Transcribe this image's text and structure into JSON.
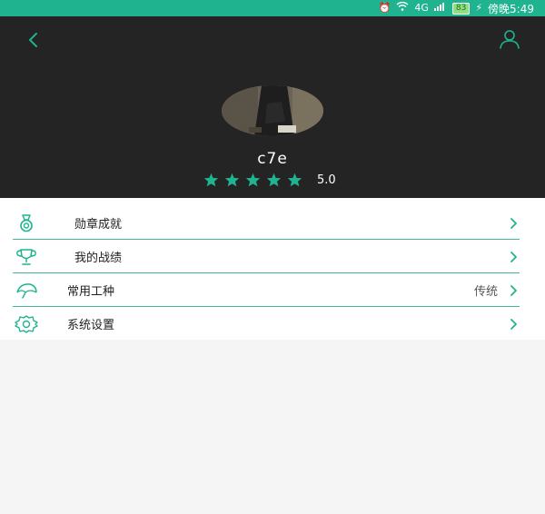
{
  "status_bar": {
    "battery": "83",
    "time": "傍晚5:49",
    "network": "4G"
  },
  "profile": {
    "username": "c7e",
    "rating_score": "5.0",
    "stars_filled": 5
  },
  "menu": {
    "items": [
      {
        "label": "勋章成就",
        "value": ""
      },
      {
        "label": "我的战绩",
        "value": ""
      },
      {
        "label": "常用工种",
        "value": "传统"
      },
      {
        "label": "系统设置",
        "value": ""
      }
    ]
  },
  "icons": {
    "back": "chevron-left-icon",
    "user": "user-icon",
    "medal": "medal-icon",
    "trophy": "trophy-icon",
    "tool": "umbrella-icon",
    "settings": "gear-icon",
    "arrow": "chevron-right-icon"
  },
  "colors": {
    "accent": "#1fb38f",
    "header_bg": "#242424",
    "star": "#1fb38f"
  }
}
